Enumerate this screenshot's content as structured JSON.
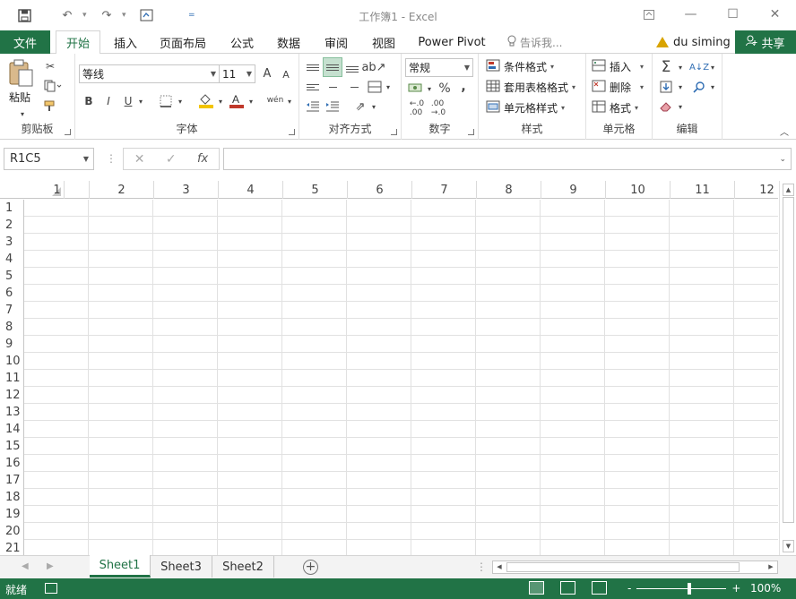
{
  "window": {
    "title": "工作簿1 - Excel",
    "qat_dropdown": "="
  },
  "tabs": {
    "file": "文件",
    "items": [
      "开始",
      "插入",
      "页面布局",
      "公式",
      "数据",
      "审阅",
      "视图",
      "Power Pivot"
    ],
    "active": "开始",
    "tell_me": "告诉我...",
    "user": "du siming",
    "share": "共享"
  },
  "ribbon": {
    "clipboard": {
      "label": "剪贴板",
      "paste": "粘贴"
    },
    "font": {
      "label": "字体",
      "name": "等线",
      "size": "11",
      "bold": "B",
      "italic": "I",
      "underline": "U",
      "grow": "A",
      "shrink": "A",
      "phonetic": "wén"
    },
    "alignment": {
      "label": "对齐方式"
    },
    "number": {
      "label": "数字",
      "format": "常规",
      "percent": "%",
      "comma": ","
    },
    "styles": {
      "label": "样式",
      "conditional": "条件格式",
      "table": "套用表格格式",
      "cell": "单元格样式"
    },
    "cells": {
      "label": "单元格",
      "insert": "插入",
      "delete": "删除",
      "format": "格式"
    },
    "editing": {
      "label": "编辑"
    }
  },
  "formula_bar": {
    "name_box": "R1C5",
    "fx": "fx",
    "value": ""
  },
  "grid": {
    "columns": [
      "1",
      "2",
      "3",
      "4",
      "5",
      "6",
      "7",
      "8",
      "9",
      "10",
      "11",
      "12"
    ],
    "rows": [
      "1",
      "2",
      "3",
      "4",
      "5",
      "6",
      "7",
      "8",
      "9",
      "10",
      "11",
      "12",
      "13",
      "14",
      "15",
      "16",
      "17",
      "18",
      "19",
      "20",
      "21"
    ]
  },
  "sheets": {
    "tabs": [
      "Sheet1",
      "Sheet3",
      "Sheet2"
    ],
    "active": "Sheet1"
  },
  "status": {
    "ready": "就绪",
    "zoom": "100%",
    "zoom_minus": "-",
    "zoom_plus": "+"
  },
  "colors": {
    "accent": "#217346",
    "fill_color": "#f2c400",
    "font_color": "#c0392b"
  }
}
